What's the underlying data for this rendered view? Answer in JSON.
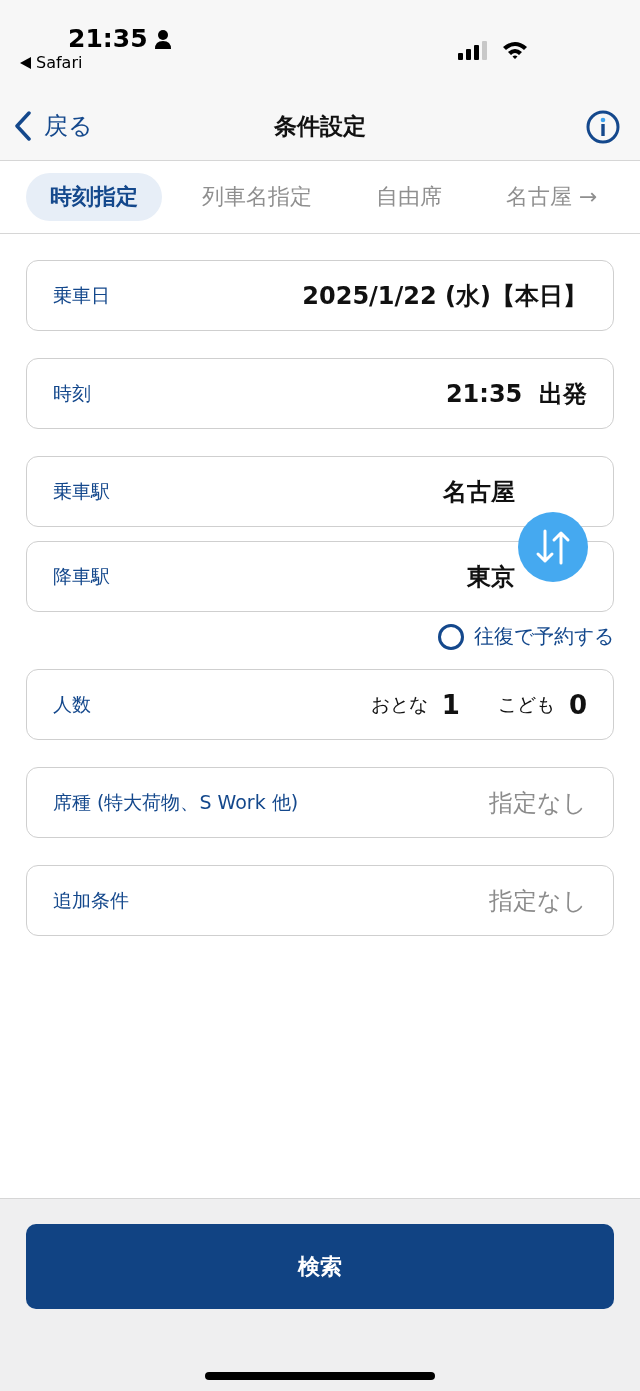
{
  "status_bar": {
    "time": "21:35",
    "back_app": "Safari"
  },
  "nav": {
    "back": "戻る",
    "title": "条件設定"
  },
  "tabs": [
    {
      "label": "時刻指定",
      "selected": true
    },
    {
      "label": "列車名指定",
      "selected": false
    },
    {
      "label": "自由席",
      "selected": false
    },
    {
      "label": "名古屋 →",
      "selected": false
    }
  ],
  "rows": [
    {
      "kind": "value",
      "label": "乗車日",
      "value": "2025/1/22 (水)【本日】"
    },
    {
      "kind": "value",
      "label": "時刻",
      "value": "21:35  出発"
    },
    {
      "kind": "station",
      "label": "乗車駅",
      "value": "名古屋"
    },
    {
      "kind": "station",
      "label": "降車駅",
      "value": "東京"
    },
    {
      "kind": "checkbox",
      "label": "往復で予約する",
      "checked": false
    },
    {
      "kind": "count",
      "label": "人数",
      "adult_label": "おとな",
      "adult": "1",
      "child_label": "こども",
      "child": "0"
    },
    {
      "kind": "empty",
      "label": "席種 (特大荷物、S Work 他)",
      "placeholder": "指定なし"
    },
    {
      "kind": "empty",
      "label": "追加条件",
      "placeholder": "指定なし"
    }
  ],
  "search_button": "検索"
}
